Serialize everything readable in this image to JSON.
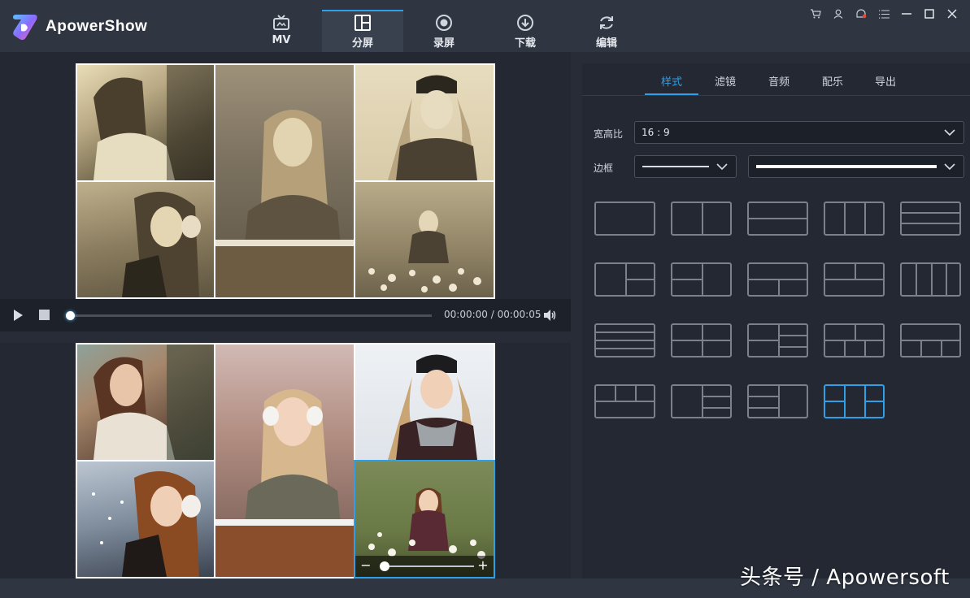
{
  "app": {
    "name": "ApowerShow"
  },
  "nav": [
    {
      "label": "MV",
      "icon": "tv-icon"
    },
    {
      "label": "分屏",
      "icon": "split-screen-icon"
    },
    {
      "label": "录屏",
      "icon": "record-icon"
    },
    {
      "label": "下载",
      "icon": "download-icon"
    },
    {
      "label": "编辑",
      "icon": "refresh-icon"
    }
  ],
  "active_nav": "分屏",
  "window_controls": [
    "cart-icon",
    "user-icon",
    "notification-icon",
    "menu-icon",
    "minimize-icon",
    "maximize-icon",
    "close-icon"
  ],
  "player": {
    "time": "00:00:00 / 00:00:05",
    "progress": 0
  },
  "zoom": {
    "minus": "−",
    "plus": "+",
    "level": 0
  },
  "right_tabs": [
    "样式",
    "滤镜",
    "音频",
    "配乐",
    "导出"
  ],
  "active_tab": "样式",
  "aspect": {
    "label": "宽高比",
    "value": "16 : 9"
  },
  "border": {
    "label": "边框"
  },
  "layouts_count": 19,
  "selected_layout": 19,
  "watermark": "头条号 / Apowersoft",
  "colors": {
    "accent": "#2ea0e8",
    "panel": "#232833",
    "topbar": "#2f3541"
  }
}
